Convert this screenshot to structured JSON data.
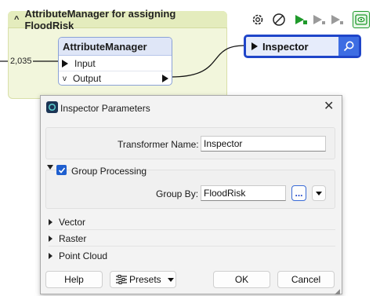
{
  "canvas": {
    "bookmark_title": "AttributeManager for assigning FloodRisk",
    "feature_count": "2,035",
    "attribute_manager": {
      "title": "AttributeManager",
      "input_port": "Input",
      "output_port": "Output"
    },
    "inspector": {
      "title": "Inspector"
    },
    "toolbar": [
      "gear-icon",
      "disable-icon",
      "run-icon",
      "run-to-icon",
      "run-from-icon",
      "inspect-cache-icon"
    ],
    "colors": {
      "bookmark": "#f2f6dc",
      "transformer": "#dfe6f7",
      "selected": "#1f45c9",
      "run_green": "#1f9a2b"
    }
  },
  "dialog": {
    "title": "Inspector Parameters",
    "transformer_name_label": "Transformer Name:",
    "transformer_name_value": "Inspector",
    "group_processing_label": "Group Processing",
    "group_processing_checked": true,
    "group_by_label": "Group By:",
    "group_by_value": "FloodRisk",
    "ellipsis": "...",
    "sections": [
      "Vector",
      "Raster",
      "Point Cloud"
    ],
    "buttons": {
      "help": "Help",
      "presets": "Presets",
      "ok": "OK",
      "cancel": "Cancel"
    }
  }
}
